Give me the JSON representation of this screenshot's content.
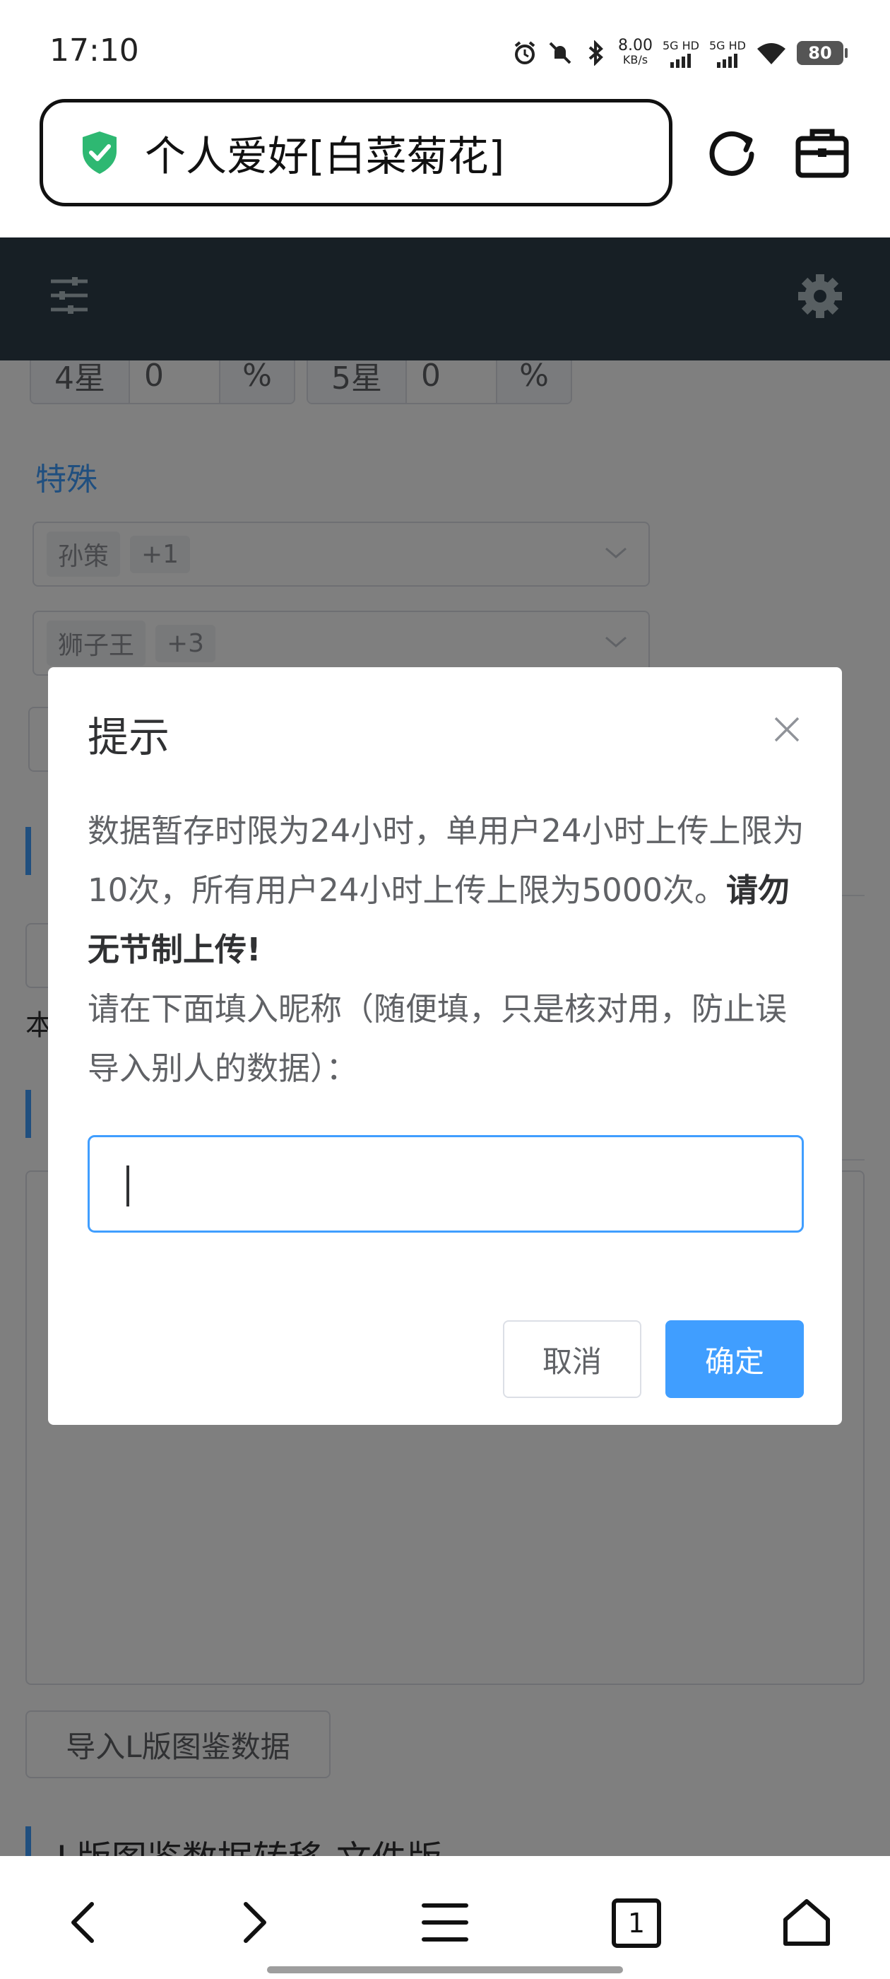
{
  "status_bar": {
    "time": "17:10",
    "net_speed_value": "8.00",
    "net_speed_unit": "KB/s",
    "sim1_label": "5G HD",
    "sim2_label": "5G HD",
    "battery": "80",
    "icons": [
      "alarm-icon",
      "mute-icon",
      "bluetooth-icon",
      "wifi-icon",
      "battery-icon"
    ]
  },
  "browser": {
    "page_title": "个人爱好[白菜菊花]",
    "icons": [
      "shield-check-icon",
      "reload-icon",
      "toolbox-icon"
    ]
  },
  "app_nav": {
    "icons": [
      "sliders-icon",
      "gear-icon"
    ]
  },
  "background": {
    "star4_label": "4星",
    "star4_value": "0",
    "star4_suffix": "%",
    "star5_label": "5星",
    "star5_value": "0",
    "star5_suffix": "%",
    "special_label": "特殊",
    "select1_tags": [
      "孙策",
      "+1"
    ],
    "select2_tags": [
      "狮子王",
      "+3"
    ],
    "partial_text": "本",
    "import_button": "导入L版图鉴数据",
    "bottom_heading": "L版图鉴数据转移-文件版"
  },
  "dialog": {
    "title": "提示",
    "body_line1": "数据暂存时限为24小时，单用户24小时上传上限为10次，所有用户24小时上传上限为5000次。",
    "body_bold": "请勿无节制上传!",
    "body_line2": "请在下面填入昵称（随便填，只是核对用，防止误导入别人的数据）：",
    "input_value": "",
    "cancel": "取消",
    "confirm": "确定"
  },
  "bottom_nav": {
    "tab_count": "1",
    "icons": [
      "back-icon",
      "forward-icon",
      "menu-icon",
      "tabs-icon",
      "home-icon"
    ]
  },
  "colors": {
    "primary": "#409eff",
    "nav_bg": "#2f3f4a",
    "shield": "#2eb872"
  }
}
